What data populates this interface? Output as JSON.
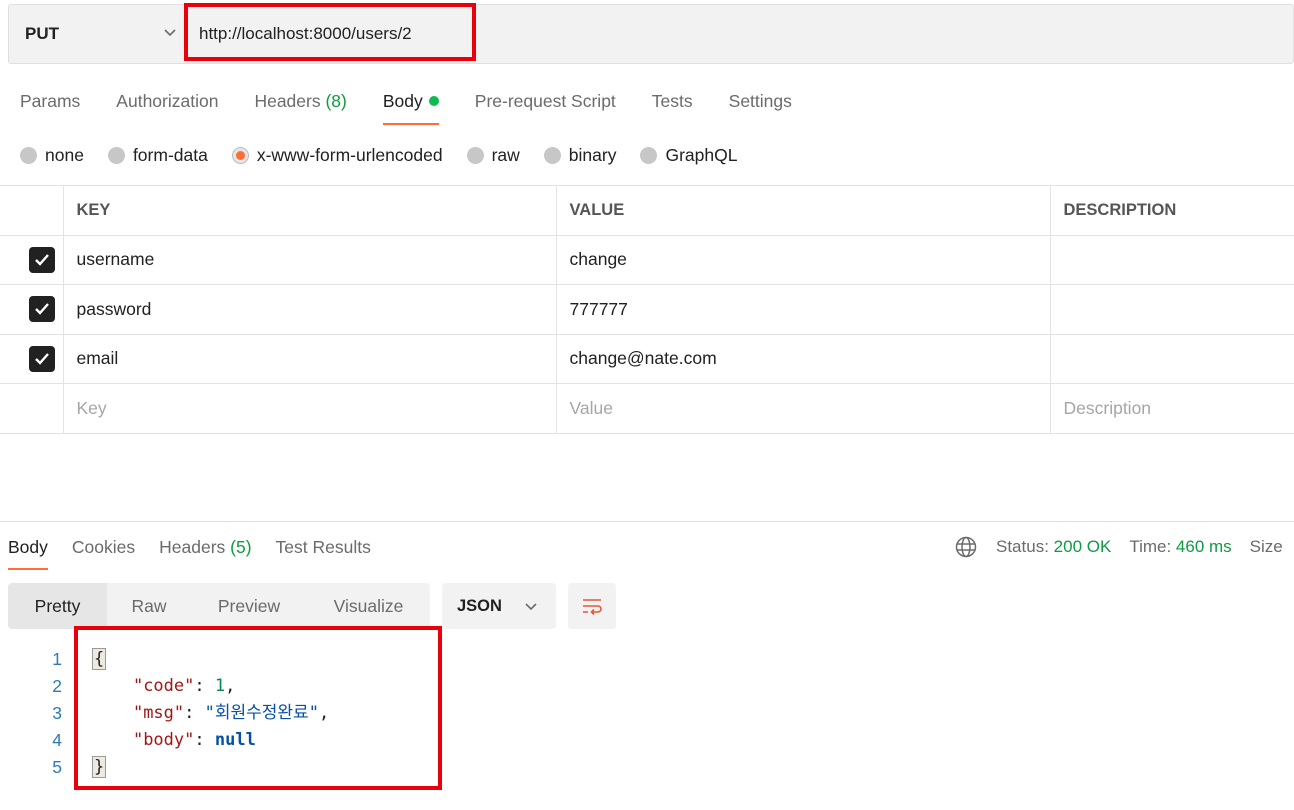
{
  "request": {
    "method": "PUT",
    "url": "http://localhost:8000/users/2"
  },
  "request_tabs": [
    {
      "label": "Params"
    },
    {
      "label": "Authorization"
    },
    {
      "label": "Headers",
      "count": "(8)"
    },
    {
      "label": "Body"
    },
    {
      "label": "Pre-request Script"
    },
    {
      "label": "Tests"
    },
    {
      "label": "Settings"
    }
  ],
  "body_types": [
    "none",
    "form-data",
    "x-www-form-urlencoded",
    "raw",
    "binary",
    "GraphQL"
  ],
  "selected_body_type": "x-www-form-urlencoded",
  "table": {
    "headers": [
      "KEY",
      "VALUE",
      "DESCRIPTION"
    ],
    "rows": [
      {
        "key": "username",
        "value": "change",
        "description": ""
      },
      {
        "key": "password",
        "value": "777777",
        "description": ""
      },
      {
        "key": "email",
        "value": "change@nate.com",
        "description": ""
      }
    ],
    "placeholder": {
      "key": "Key",
      "value": "Value",
      "description": "Description"
    }
  },
  "response_tabs": [
    {
      "label": "Body"
    },
    {
      "label": "Cookies"
    },
    {
      "label": "Headers",
      "count": "(5)"
    },
    {
      "label": "Test Results"
    }
  ],
  "response_meta": {
    "status_label": "Status:",
    "status_value": "200 OK",
    "time_label": "Time:",
    "time_value": "460 ms",
    "size_label": "Size"
  },
  "view_modes": [
    "Pretty",
    "Raw",
    "Preview",
    "Visualize"
  ],
  "format": "JSON",
  "code": {
    "line_numbers": [
      "1",
      "2",
      "3",
      "4",
      "5"
    ],
    "open_brace": "{",
    "close_brace": "}",
    "code_key": "\"code\"",
    "code_val": "1",
    "msg_key": "\"msg\"",
    "msg_val": "\"회원수정완료\"",
    "body_key": "\"body\"",
    "body_val": "null"
  },
  "colors": {
    "accent": "#ff6c37",
    "highlight_box": "#e8000b",
    "success": "#0d9c42"
  }
}
